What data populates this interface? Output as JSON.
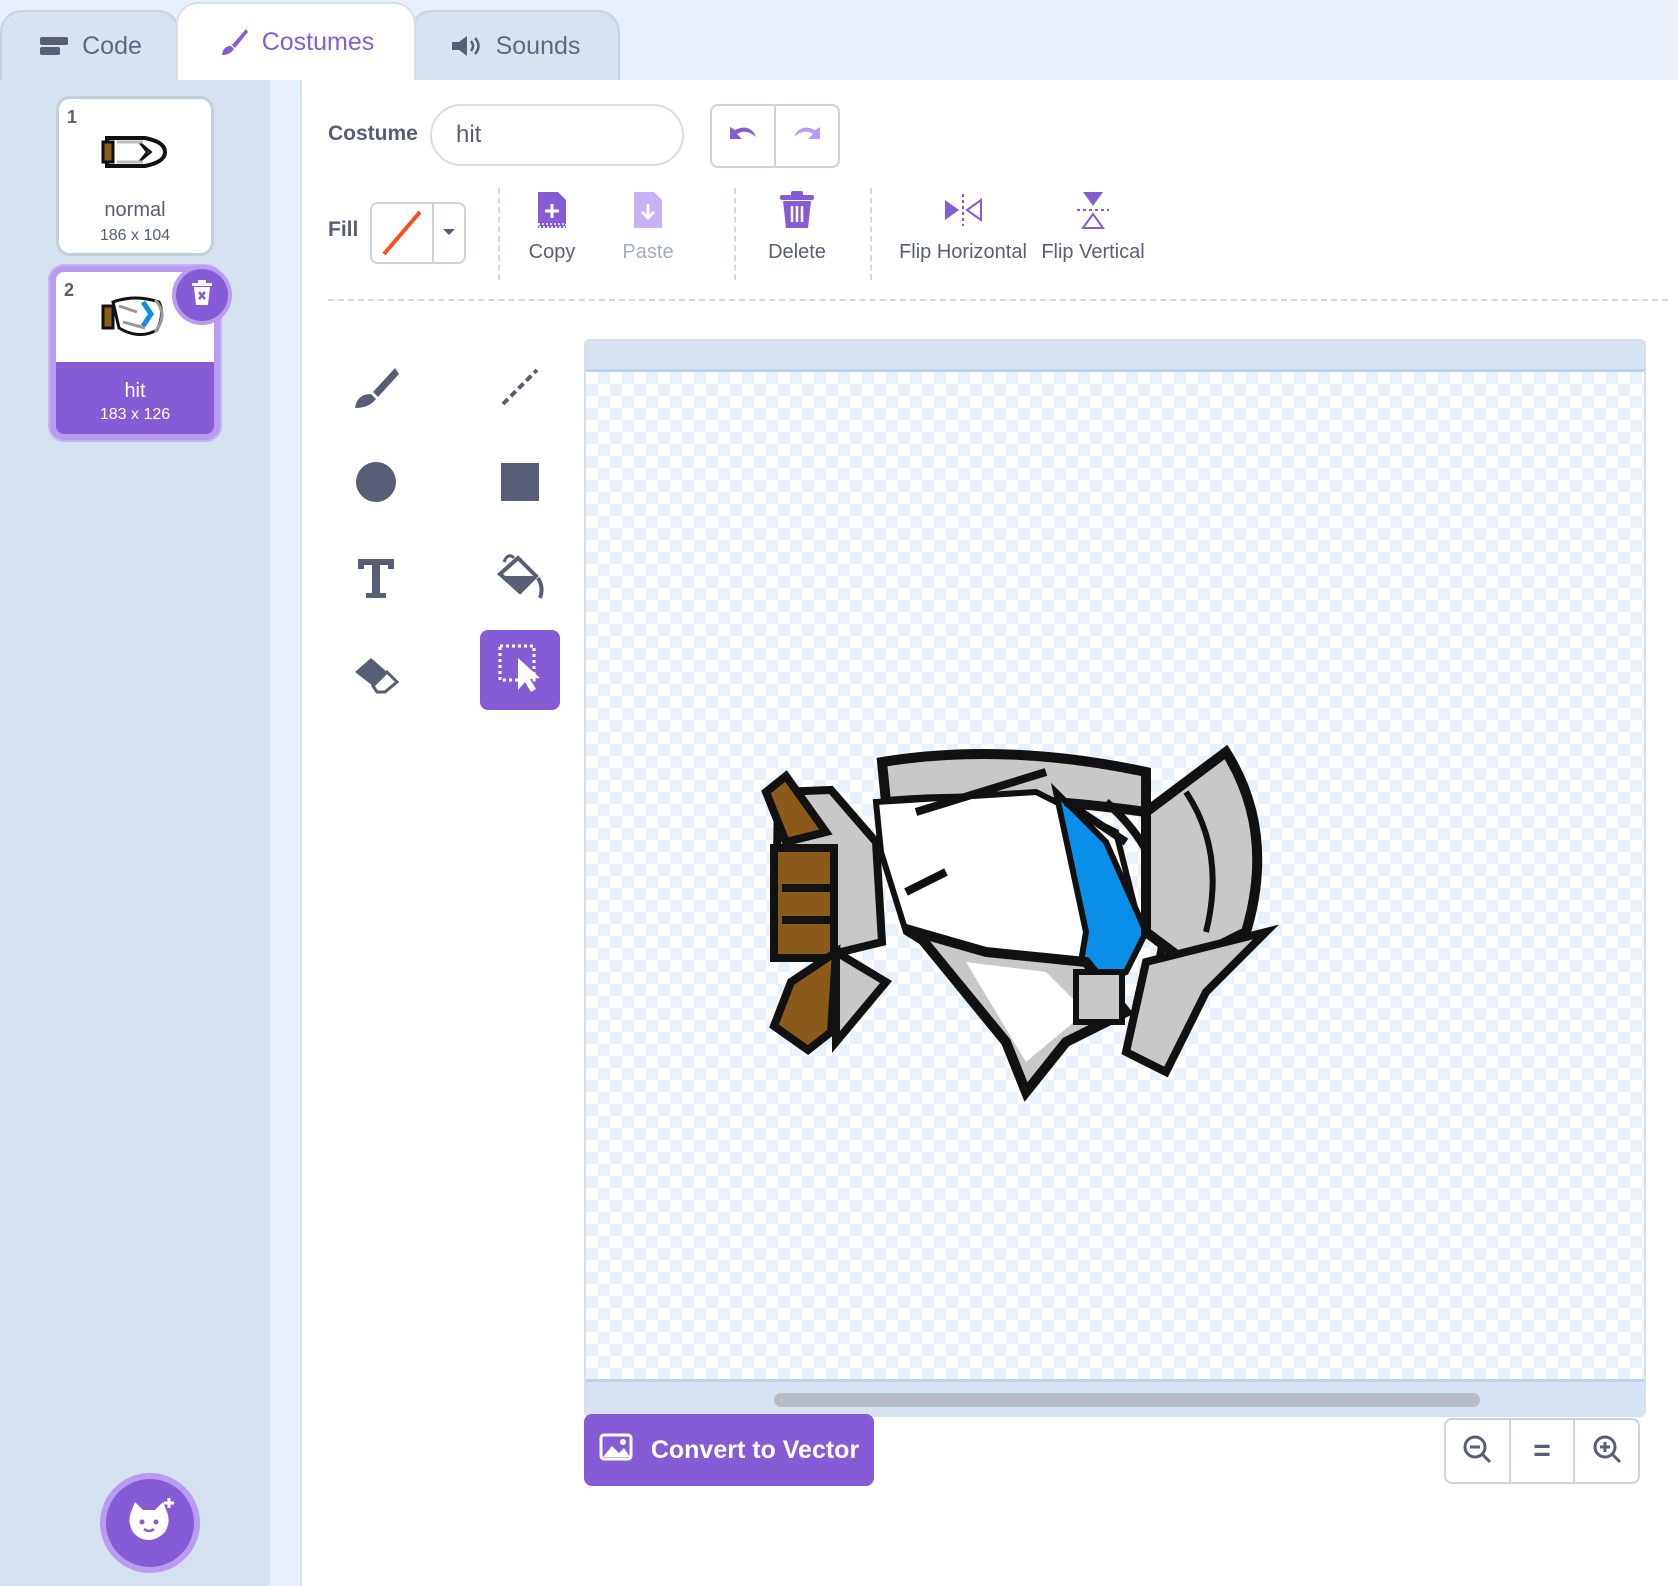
{
  "tabs": [
    {
      "label": "Code",
      "icon": "code-blocks-icon"
    },
    {
      "label": "Costumes",
      "icon": "paintbrush-icon",
      "active": true
    },
    {
      "label": "Sounds",
      "icon": "speaker-icon"
    }
  ],
  "costumes": [
    {
      "number": "1",
      "name": "normal",
      "size": "186 x 104"
    },
    {
      "number": "2",
      "name": "hit",
      "size": "183 x 126",
      "selected": true
    }
  ],
  "editor": {
    "costume_label": "Costume",
    "costume_name": "hit",
    "fill_label": "Fill",
    "tools": {
      "copy": "Copy",
      "paste": "Paste",
      "delete": "Delete",
      "flip_horizontal": "Flip Horizontal",
      "flip_vertical": "Flip Vertical"
    },
    "convert_button": "Convert to Vector",
    "zoom_reset": "="
  },
  "colors": {
    "accent": "#855cd6",
    "fill_none_slash": "#ff4d1a",
    "costume_blue": "#0a8fe8",
    "costume_brown": "#8b5a1b"
  }
}
